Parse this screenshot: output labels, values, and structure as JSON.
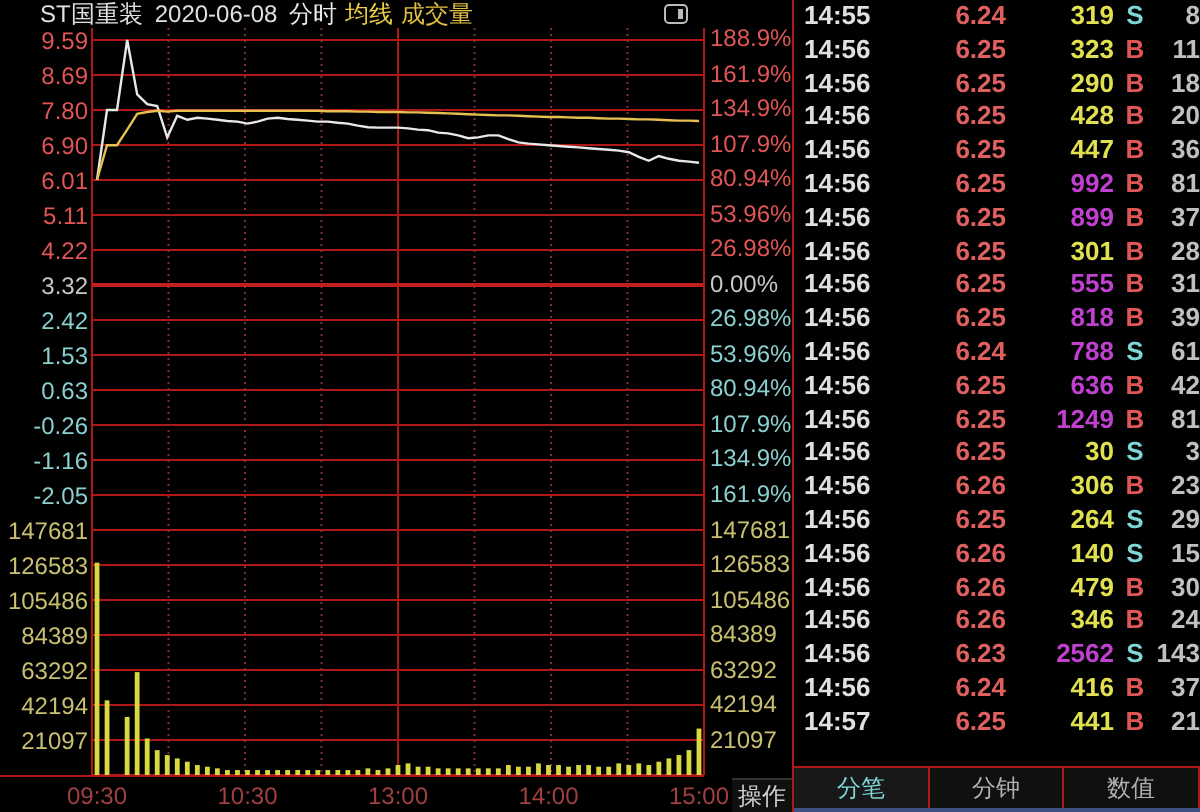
{
  "header": {
    "stock": "ST国重装",
    "date": "2020-06-08"
  },
  "price_chart": {
    "percent_labels": [
      {
        "text": "188.9%",
        "kind": "up"
      },
      {
        "text": "161.9%",
        "kind": "up"
      },
      {
        "text": "134.9%",
        "kind": "up"
      },
      {
        "text": "107.9%",
        "kind": "up"
      },
      {
        "text": "80.94%",
        "kind": "up"
      },
      {
        "text": "53.96%",
        "kind": "up"
      },
      {
        "text": "26.98%",
        "kind": "up"
      },
      {
        "text": "0.00%",
        "kind": "flat"
      },
      {
        "text": "26.98%",
        "kind": "down"
      },
      {
        "text": "53.96%",
        "kind": "down"
      },
      {
        "text": "80.94%",
        "kind": "down"
      },
      {
        "text": "107.9%",
        "kind": "down"
      },
      {
        "text": "134.9%",
        "kind": "down"
      },
      {
        "text": "161.9%",
        "kind": "down"
      }
    ],
    "chart_data": {
      "type": "line",
      "grid": true,
      "ref_lines": [
        {
          "axis": "y",
          "value": 3.32
        }
      ],
      "ylim": [
        -2.05,
        9.59
      ],
      "yticks": [
        {
          "value": 9.59,
          "label": "9.59"
        },
        {
          "value": 8.69,
          "label": "8.69"
        },
        {
          "value": 7.8,
          "label": "7.80"
        },
        {
          "value": 6.9,
          "label": "6.90"
        },
        {
          "value": 6.01,
          "label": "6.01"
        },
        {
          "value": 5.11,
          "label": "5.11"
        },
        {
          "value": 4.22,
          "label": "4.22"
        },
        {
          "value": 3.32,
          "label": "3.32"
        },
        {
          "value": 2.42,
          "label": "2.42"
        },
        {
          "value": 1.53,
          "label": "1.53"
        },
        {
          "value": 0.63,
          "label": "0.63"
        },
        {
          "value": -0.26,
          "label": "-0.26"
        },
        {
          "value": -1.16,
          "label": "-1.16"
        },
        {
          "value": -2.05,
          "label": "-2.05"
        }
      ],
      "categories": [
        null,
        null,
        null,
        null,
        null,
        null,
        null,
        null,
        null,
        null,
        null,
        null,
        null,
        null,
        null,
        null,
        null,
        null,
        null,
        null,
        null,
        null,
        null,
        null,
        null,
        null,
        null,
        null,
        null,
        null,
        null,
        null,
        null,
        null,
        null,
        null,
        null,
        null,
        null,
        null,
        null,
        null,
        null,
        null,
        null,
        null,
        null,
        null,
        null,
        null,
        null,
        null,
        null,
        null,
        null,
        null,
        null,
        null,
        null,
        null,
        null
      ],
      "series": [
        {
          "name": "分时",
          "color": "#e8e8e8",
          "values": [
            6.01,
            7.8,
            7.8,
            9.59,
            8.2,
            7.95,
            7.9,
            7.1,
            7.65,
            7.55,
            7.6,
            7.58,
            7.55,
            7.52,
            7.5,
            7.45,
            7.5,
            7.58,
            7.6,
            7.57,
            7.55,
            7.53,
            7.5,
            7.5,
            7.47,
            7.45,
            7.4,
            7.36,
            7.35,
            7.35,
            7.35,
            7.33,
            7.3,
            7.28,
            7.22,
            7.2,
            7.15,
            7.08,
            7.1,
            7.15,
            7.15,
            7.05,
            6.97,
            6.94,
            6.92,
            6.9,
            6.88,
            6.86,
            6.84,
            6.82,
            6.8,
            6.78,
            6.76,
            6.72,
            6.6,
            6.5,
            6.62,
            6.55,
            6.5,
            6.48,
            6.45
          ]
        },
        {
          "name": "均线",
          "color": "#e8c050",
          "values": [
            6.01,
            6.9,
            6.9,
            7.3,
            7.7,
            7.75,
            7.78,
            7.76,
            7.78,
            7.78,
            7.78,
            7.78,
            7.78,
            7.78,
            7.78,
            7.78,
            7.78,
            7.78,
            7.78,
            7.78,
            7.78,
            7.78,
            7.78,
            7.77,
            7.77,
            7.77,
            7.76,
            7.76,
            7.75,
            7.75,
            7.75,
            7.74,
            7.74,
            7.73,
            7.72,
            7.71,
            7.7,
            7.69,
            7.68,
            7.67,
            7.66,
            7.66,
            7.65,
            7.64,
            7.63,
            7.62,
            7.62,
            7.61,
            7.6,
            7.6,
            7.59,
            7.58,
            7.58,
            7.57,
            7.56,
            7.56,
            7.55,
            7.54,
            7.53,
            7.53,
            7.52
          ]
        }
      ]
    }
  },
  "volume_chart": {
    "right_labels": [
      "147681",
      "126583",
      "105486",
      "84389",
      "63292",
      "42194",
      "21097"
    ],
    "action_button": "操作",
    "chart_data": {
      "type": "bar",
      "grid": true,
      "ylim": [
        0,
        147681
      ],
      "yticks": [
        {
          "value": 147681,
          "label": "147681"
        },
        {
          "value": 126583,
          "label": "126583"
        },
        {
          "value": 105486,
          "label": "105486"
        },
        {
          "value": 84389,
          "label": "84389"
        },
        {
          "value": 63292,
          "label": "63292"
        },
        {
          "value": 42194,
          "label": "42194"
        },
        {
          "value": 21097,
          "label": "21097"
        }
      ],
      "categories": [
        "09:30",
        null,
        null,
        null,
        null,
        null,
        null,
        null,
        null,
        null,
        null,
        null,
        null,
        null,
        null,
        "10:30",
        null,
        null,
        null,
        null,
        null,
        null,
        null,
        null,
        null,
        null,
        null,
        null,
        null,
        null,
        "13:00",
        null,
        null,
        null,
        null,
        null,
        null,
        null,
        null,
        null,
        null,
        null,
        null,
        null,
        null,
        "14:00",
        null,
        null,
        null,
        null,
        null,
        null,
        null,
        null,
        null,
        null,
        null,
        null,
        null,
        null,
        "15:00"
      ],
      "series": [
        {
          "name": "成交量",
          "color": "#d8d840",
          "values": [
            128000,
            45000,
            0,
            35000,
            62000,
            22000,
            15000,
            12000,
            10000,
            8000,
            6000,
            5000,
            4000,
            3000,
            3000,
            3000,
            3000,
            3000,
            3000,
            3000,
            3000,
            3000,
            3000,
            3000,
            3000,
            3000,
            3000,
            4000,
            3000,
            4000,
            6000,
            7000,
            5000,
            5000,
            4000,
            4000,
            4000,
            4000,
            4000,
            4000,
            4000,
            6000,
            5000,
            5000,
            7000,
            6000,
            6000,
            5000,
            6000,
            6000,
            5000,
            5000,
            7000,
            6000,
            7000,
            6000,
            8000,
            10000,
            12000,
            15000,
            28000
          ]
        }
      ]
    }
  },
  "trades": [
    {
      "time": "14:55",
      "price": "6.24",
      "volume": "319",
      "large": false,
      "side": "S",
      "kind": "sell",
      "column_5": "8"
    },
    {
      "time": "14:56",
      "price": "6.25",
      "volume": "323",
      "large": false,
      "side": "B",
      "kind": "buy",
      "column_5": "11"
    },
    {
      "time": "14:56",
      "price": "6.25",
      "volume": "290",
      "large": false,
      "side": "B",
      "kind": "buy",
      "column_5": "18"
    },
    {
      "time": "14:56",
      "price": "6.25",
      "volume": "428",
      "large": false,
      "side": "B",
      "kind": "buy",
      "column_5": "20"
    },
    {
      "time": "14:56",
      "price": "6.25",
      "volume": "447",
      "large": false,
      "side": "B",
      "kind": "buy",
      "column_5": "36"
    },
    {
      "time": "14:56",
      "price": "6.25",
      "volume": "992",
      "large": true,
      "side": "B",
      "kind": "buy",
      "column_5": "81"
    },
    {
      "time": "14:56",
      "price": "6.25",
      "volume": "899",
      "large": true,
      "side": "B",
      "kind": "buy",
      "column_5": "37"
    },
    {
      "time": "14:56",
      "price": "6.25",
      "volume": "301",
      "large": false,
      "side": "B",
      "kind": "buy",
      "column_5": "28"
    },
    {
      "time": "14:56",
      "price": "6.25",
      "volume": "555",
      "large": true,
      "side": "B",
      "kind": "buy",
      "column_5": "31"
    },
    {
      "time": "14:56",
      "price": "6.25",
      "volume": "818",
      "large": true,
      "side": "B",
      "kind": "buy",
      "column_5": "39"
    },
    {
      "time": "14:56",
      "price": "6.24",
      "volume": "788",
      "large": true,
      "side": "S",
      "kind": "sell",
      "column_5": "61"
    },
    {
      "time": "14:56",
      "price": "6.25",
      "volume": "636",
      "large": true,
      "side": "B",
      "kind": "buy",
      "column_5": "42"
    },
    {
      "time": "14:56",
      "price": "6.25",
      "volume": "1249",
      "large": true,
      "side": "B",
      "kind": "buy",
      "column_5": "81"
    },
    {
      "time": "14:56",
      "price": "6.25",
      "volume": "30",
      "large": false,
      "side": "S",
      "kind": "sell",
      "column_5": "3"
    },
    {
      "time": "14:56",
      "price": "6.26",
      "volume": "306",
      "large": false,
      "side": "B",
      "kind": "buy",
      "column_5": "23"
    },
    {
      "time": "14:56",
      "price": "6.25",
      "volume": "264",
      "large": false,
      "side": "S",
      "kind": "sell",
      "column_5": "29"
    },
    {
      "time": "14:56",
      "price": "6.26",
      "volume": "140",
      "large": false,
      "side": "S",
      "kind": "sell",
      "column_5": "15"
    },
    {
      "time": "14:56",
      "price": "6.26",
      "volume": "479",
      "large": false,
      "side": "B",
      "kind": "buy",
      "column_5": "30"
    },
    {
      "time": "14:56",
      "price": "6.26",
      "volume": "346",
      "large": false,
      "side": "B",
      "kind": "buy",
      "column_5": "24"
    },
    {
      "time": "14:56",
      "price": "6.23",
      "volume": "2562",
      "large": true,
      "side": "S",
      "kind": "sell",
      "column_5": "143"
    },
    {
      "time": "14:56",
      "price": "6.24",
      "volume": "416",
      "large": false,
      "side": "B",
      "kind": "buy",
      "column_5": "37"
    },
    {
      "time": "14:57",
      "price": "6.25",
      "volume": "441",
      "large": false,
      "side": "B",
      "kind": "buy",
      "column_5": "21"
    }
  ],
  "tabs": [
    {
      "label": "分笔",
      "selected": true
    },
    {
      "label": "分钟",
      "selected": false
    },
    {
      "label": "数值",
      "selected": false
    }
  ]
}
